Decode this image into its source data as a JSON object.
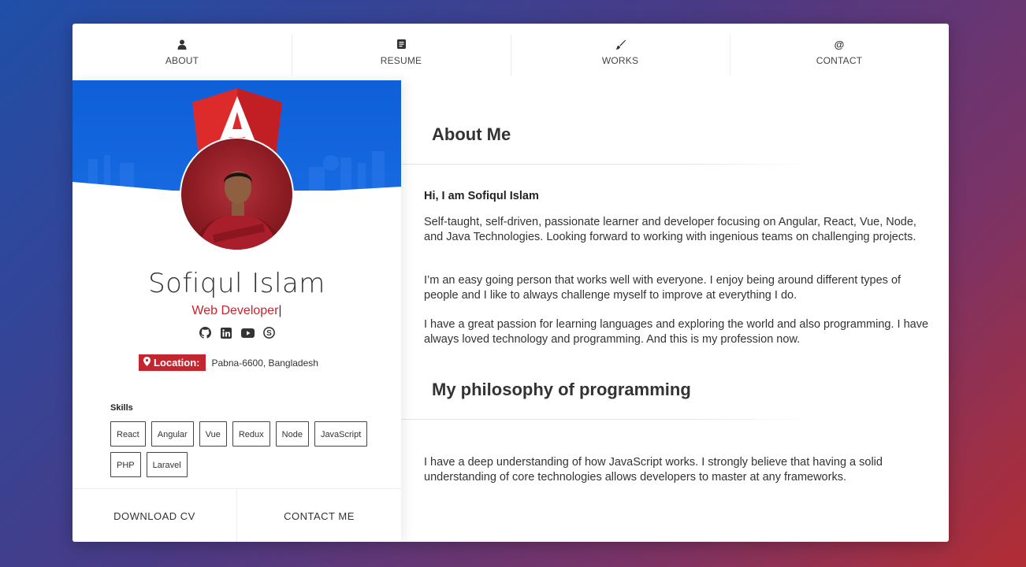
{
  "nav": {
    "items": [
      {
        "label": "ABOUT",
        "icon": "user-icon"
      },
      {
        "label": "RESUME",
        "icon": "document-icon"
      },
      {
        "label": "WORKS",
        "icon": "brush-icon"
      },
      {
        "label": "CONTACT",
        "icon": "at-icon"
      }
    ]
  },
  "profile": {
    "name": "Sofiqul Islam",
    "role": "Web Developer",
    "role_caret": "|",
    "socials": [
      "github-icon",
      "linkedin-icon",
      "youtube-icon",
      "skype-icon"
    ],
    "location_label": "Location:",
    "location_value": "Pabna-6600, Bangladesh",
    "skills_title": "Skills",
    "skills": [
      "React",
      "Angular",
      "Vue",
      "Redux",
      "Node",
      "JavaScript",
      "PHP",
      "Laravel"
    ],
    "download_cv": "DOWNLOAD CV",
    "contact_me": "CONTACT ME"
  },
  "about": {
    "title": "About Me",
    "greeting": "Hi, I am Sofiqul Islam",
    "p1": "Self-taught, self-driven, passionate learner and developer focusing on Angular, React, Vue, Node, and Java Technologies. Looking forward to working with ingenious teams on challenging projects.",
    "p2": "I’m an easy going person that works well with everyone. I enjoy being around different types of people and I like to always challenge myself to improve at everything I do.",
    "p3": "I have a great passion for learning languages and exploring the world and also programming. I have always loved technology and programming. And this is my profession now."
  },
  "philosophy": {
    "title": "My philosophy of programming",
    "p1": "I have a deep understanding of how JavaScript works. I strongly believe that having a solid understanding of core technologies allows developers to master at any frameworks."
  },
  "colors": {
    "accent": "#c3262e",
    "banner": "#1769e0"
  }
}
